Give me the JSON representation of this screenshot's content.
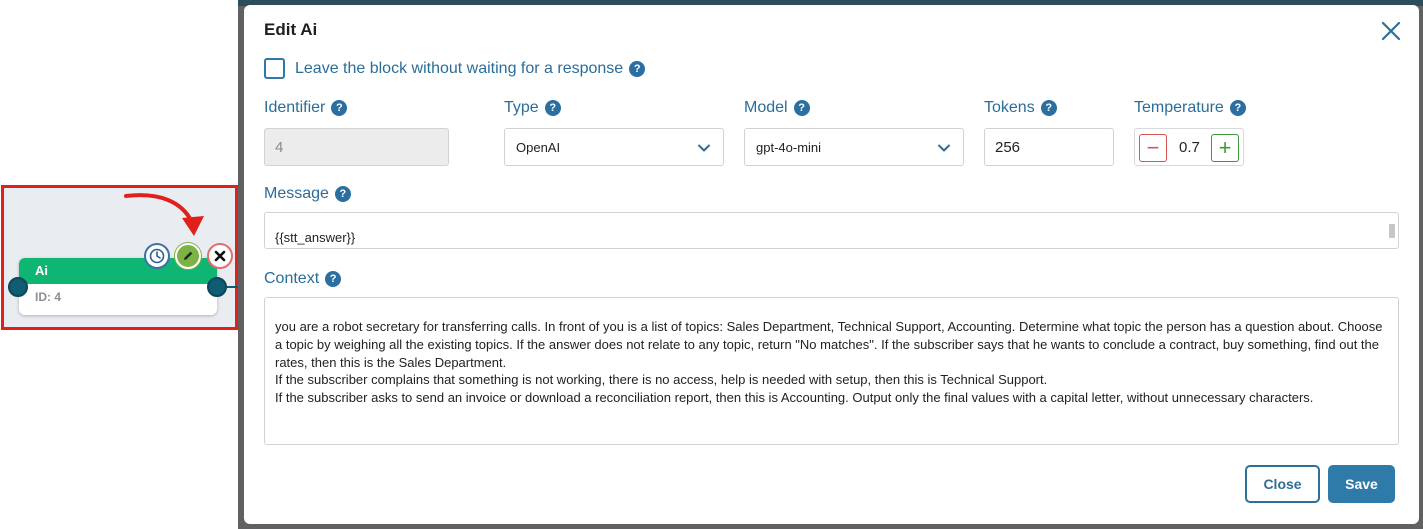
{
  "modal": {
    "title": "Edit Ai",
    "leave_block_label": "Leave the block without waiting for a response",
    "help_glyph": "?",
    "fields": {
      "identifier": {
        "label": "Identifier",
        "value": "4"
      },
      "type": {
        "label": "Type",
        "value": "OpenAI"
      },
      "model": {
        "label": "Model",
        "value": "gpt-4o-mini"
      },
      "tokens": {
        "label": "Tokens",
        "value": "256"
      },
      "temperature": {
        "label": "Temperature",
        "value": "0.7",
        "minus": "−",
        "plus": "+"
      },
      "message": {
        "label": "Message",
        "value": "{{stt_answer}}"
      },
      "context": {
        "label": "Context",
        "value": "you are a robot secretary for transferring calls. In front of you is a list of topics: Sales Department, Technical Support, Accounting. Determine what topic the person has a question about. Choose a topic by weighing all the existing topics. If the answer does not relate to any topic, return \"No matches\". If the subscriber says that he wants to conclude a contract, buy something, find out the rates, then this is the Sales Department.\nIf the subscriber complains that something is not working, there is no access, help is needed with setup, then this is Technical Support.\nIf the subscriber asks to send an invoice or download a reconciliation report, then this is Accounting. Output only the final values with a capital letter, without unnecessary characters."
      }
    },
    "buttons": {
      "close": "Close",
      "save": "Save"
    }
  },
  "node": {
    "title": "Ai",
    "id_label": "ID: 4",
    "icons": [
      "history-icon",
      "pencil-icon",
      "close-icon"
    ]
  },
  "colors": {
    "accent": "#2e7aa9",
    "label": "#2a6d99",
    "node_header": "#0fb573",
    "highlight": "#e0211b",
    "edit_button": "#7db244"
  }
}
